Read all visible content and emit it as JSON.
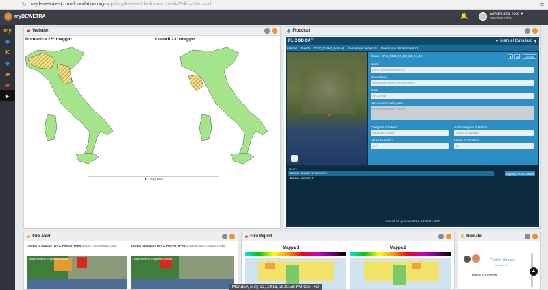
{
  "browser": {
    "url_host": "mydewetratest.cimafoundation.org",
    "url_path": "/apps/mydewetra/dashboard.html#/?skin=3&u=md"
  },
  "app": {
    "logo_text": "myDEWETRA",
    "user_name": "Emanuela Toto",
    "user_role": "[member cima]"
  },
  "sidebar": {
    "items": [
      {
        "label": "my",
        "icon": "my-icon",
        "color": "#e0a020"
      },
      {
        "label": "◆",
        "icon": "diamond-icon",
        "color": "#2d8ccf"
      },
      {
        "label": "K",
        "icon": "k-icon",
        "color": "#e0a020"
      },
      {
        "label": "◆",
        "icon": "sensor-icon",
        "color": "#2d8ccf"
      },
      {
        "label": "▰",
        "icon": "fire-icon",
        "color": "#f0932b"
      },
      {
        "label": "▰",
        "icon": "alert-icon",
        "color": "#e74c3c"
      },
      {
        "label": "▸",
        "icon": "play-icon",
        "color": "#ffffff"
      }
    ]
  },
  "webalert": {
    "title": "Webalert",
    "map1_title": "Domenica 22° maggio",
    "map2_title": "Lunedì 23° maggio",
    "legend": "Legenda"
  },
  "floodcat": {
    "title": "Floodcat",
    "inner_logo": "FLOODCAT",
    "inner_user": "Manuel Cavallaro",
    "breadcrumb": [
      "/ Home",
      "Eventi",
      "TEST_Comitt_Manuel",
      "Fenomeno numero 1",
      "Danno uno del fenomeno 1"
    ],
    "danno_id": "Danno: DAN_2016_01_28_14_24_10",
    "fields": {
      "nome_label": "Nome:",
      "nome_value": "Danno uno del fenomeno 1",
      "descr_label": "Descrizione:",
      "descr_value": "Descrizione danno 1 del fenomeno 1",
      "data_label": "Data:",
      "data_value": "28/01/2016",
      "meccanismo_label": "Meccanismo della piena:",
      "meccanismo_value": "Eliminare dalla lista di kibra",
      "categoria_label": "Categoria di Danno:",
      "categoria_value": "Sostanza Torrente",
      "sottocat_label": "Sottocategoria di Danno:",
      "sottocat_value": "Scarico di rischiare",
      "vnum_label": "Valore Numerico:",
      "vnum_value": "100",
      "vecon_label": "Valore Economico:",
      "vecon_value": "10"
    },
    "close_label": "Chiudi",
    "list_header": "Danni",
    "list_items": [
      "Danno uno del fenomeno 1",
      "Danno numero 2"
    ],
    "add_button": "Aggiungi Nuovo danno",
    "footer": "venerdì 29 gennaio 2016, 14:42:54 CET"
  },
  "fire_alert": {
    "title": "Fire Alert",
    "label1": "LIVELLI DI SUSCETTIVITA' PREVISTI PER",
    "date1": "SABATO 06 GENNAIO 2016",
    "label2": "LIVELLI DI SUSCETTIVITA' PREVISTI PER",
    "date2": "DOMENICA 07 GENNAIO 2016",
    "map_text": "Italia Venezia Bergamo Genova"
  },
  "fire_report": {
    "title": "Fire Report",
    "map1": "Mappa 1",
    "map2": "Mappa 2"
  },
  "kumale": {
    "title": "Kumalé",
    "contact_name": "Cosimo Versace",
    "contact_sub": "1 mese fa",
    "message": "Piena a Vicenza"
  },
  "status": {
    "time": "Monday, May 23, 2016, 3:20:58 PM GMT+2"
  }
}
